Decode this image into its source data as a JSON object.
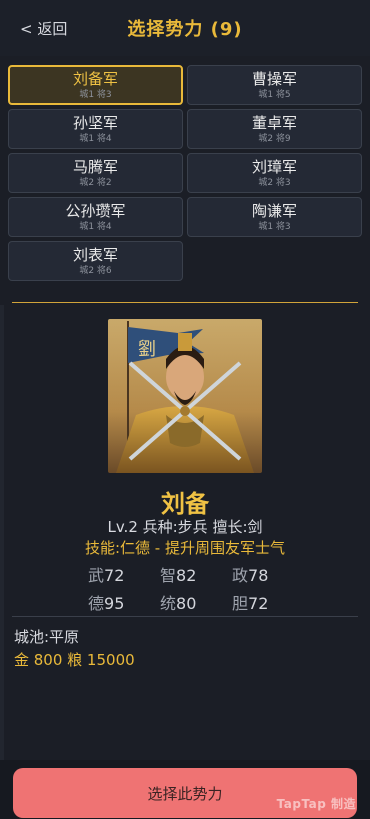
{
  "header": {
    "back_label": "< 返回",
    "title": "选择势力 (9)"
  },
  "factions": [
    {
      "name": "刘备军",
      "stats": "城1 将3",
      "selected": true
    },
    {
      "name": "曹操军",
      "stats": "城1 将5",
      "selected": false
    },
    {
      "name": "孙坚军",
      "stats": "城1 将4",
      "selected": false
    },
    {
      "name": "董卓军",
      "stats": "城2 将9",
      "selected": false
    },
    {
      "name": "马腾军",
      "stats": "城2 将2",
      "selected": false
    },
    {
      "name": "刘璋军",
      "stats": "城2 将3",
      "selected": false
    },
    {
      "name": "公孙瓒军",
      "stats": "城1 将4",
      "selected": false
    },
    {
      "name": "陶谦军",
      "stats": "城1 将3",
      "selected": false
    },
    {
      "name": "刘表军",
      "stats": "城2 将6",
      "selected": false
    }
  ],
  "leader": {
    "name": "刘备",
    "info": "Lv.2  兵种:步兵  擅长:剑",
    "skill": "技能:仁德 - 提升周围友军士气",
    "banner_char": "劉",
    "stats": [
      {
        "label": "武",
        "value": "72"
      },
      {
        "label": "智",
        "value": "82"
      },
      {
        "label": "政",
        "value": "78"
      },
      {
        "label": "德",
        "value": "95"
      },
      {
        "label": "统",
        "value": "80"
      },
      {
        "label": "胆",
        "value": "72"
      }
    ]
  },
  "city": "城池:平原",
  "resources": "金 800  粮 15000",
  "select_button": "选择此势力",
  "watermark": "TapTap 制造",
  "colors": {
    "accent_gold": "#e9b93a",
    "button": "#ef7373",
    "background": "#1b1e26"
  }
}
